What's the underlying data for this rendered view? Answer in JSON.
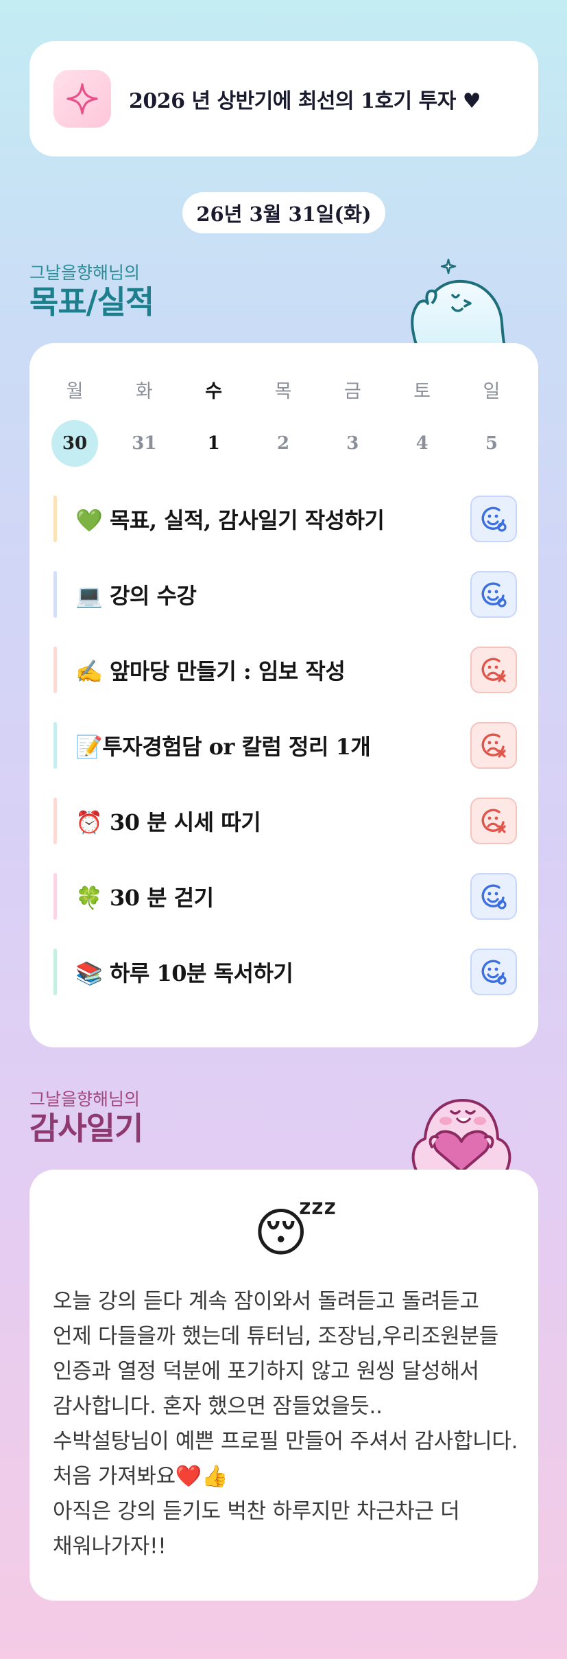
{
  "goal": {
    "icon": "sparkle-icon",
    "text": "2026 년 상반기에 최선의 1호기 투자 ♥"
  },
  "date": "26년 3월 31일(화)",
  "goals_section": {
    "subtitle": "그날을향해님의",
    "title": "목표/실적"
  },
  "week": {
    "days": [
      "월",
      "화",
      "수",
      "목",
      "금",
      "토",
      "일"
    ],
    "dates": [
      "30",
      "31",
      "1",
      "2",
      "3",
      "4",
      "5"
    ],
    "today_index": 2,
    "selected_index": 0
  },
  "tasks": [
    {
      "label": "💚 목표, 실적, 감사일기 작성하기",
      "status": "done",
      "bar_color": "#fde2b8"
    },
    {
      "label": "💻 강의 수강",
      "status": "done",
      "bar_color": "#d3def8"
    },
    {
      "label": "✍️ 앞마당 만들기 : 임보 작성",
      "status": "fail",
      "bar_color": "#fdd9d4"
    },
    {
      "label": "📝투자경험담 or 칼럼 정리 1개",
      "status": "fail",
      "bar_color": "#c6eef0"
    },
    {
      "label": "⏰ 30 분 시세 따기",
      "status": "fail",
      "bar_color": "#fdd9d4"
    },
    {
      "label": "🍀 30 분 걷기",
      "status": "done",
      "bar_color": "#fcd4e6"
    },
    {
      "label": "📚 하루 10분 독서하기",
      "status": "done",
      "bar_color": "#c5f0df"
    }
  ],
  "diary_section": {
    "subtitle": "그날을향해님의",
    "title": "감사일기"
  },
  "diary": {
    "mood_emoji": "😴",
    "text": "오늘 강의 듣다 계속 잠이와서 돌려듣고 돌려듣고 언제 다들을까 했는데 튜터님, 조장님,우리조원분들 인증과 열정 덕분에 포기하지 않고 원씽 달성해서 감사합니다. 혼자 했으면 잠들었을듯..\n수박설탕님이 예쁜 프로필 만들어 주셔서 감사합니다. 처음 가져봐요❤️👍\n아직은 강의 듣기도 벅찬 하루지만 차근차근 더 채워나가자!!"
  },
  "colors": {
    "done_icon": "#3b6fe0",
    "fail_icon": "#e0554a",
    "goal_title": "#1e7f8c",
    "diary_title": "#8e3a70"
  }
}
